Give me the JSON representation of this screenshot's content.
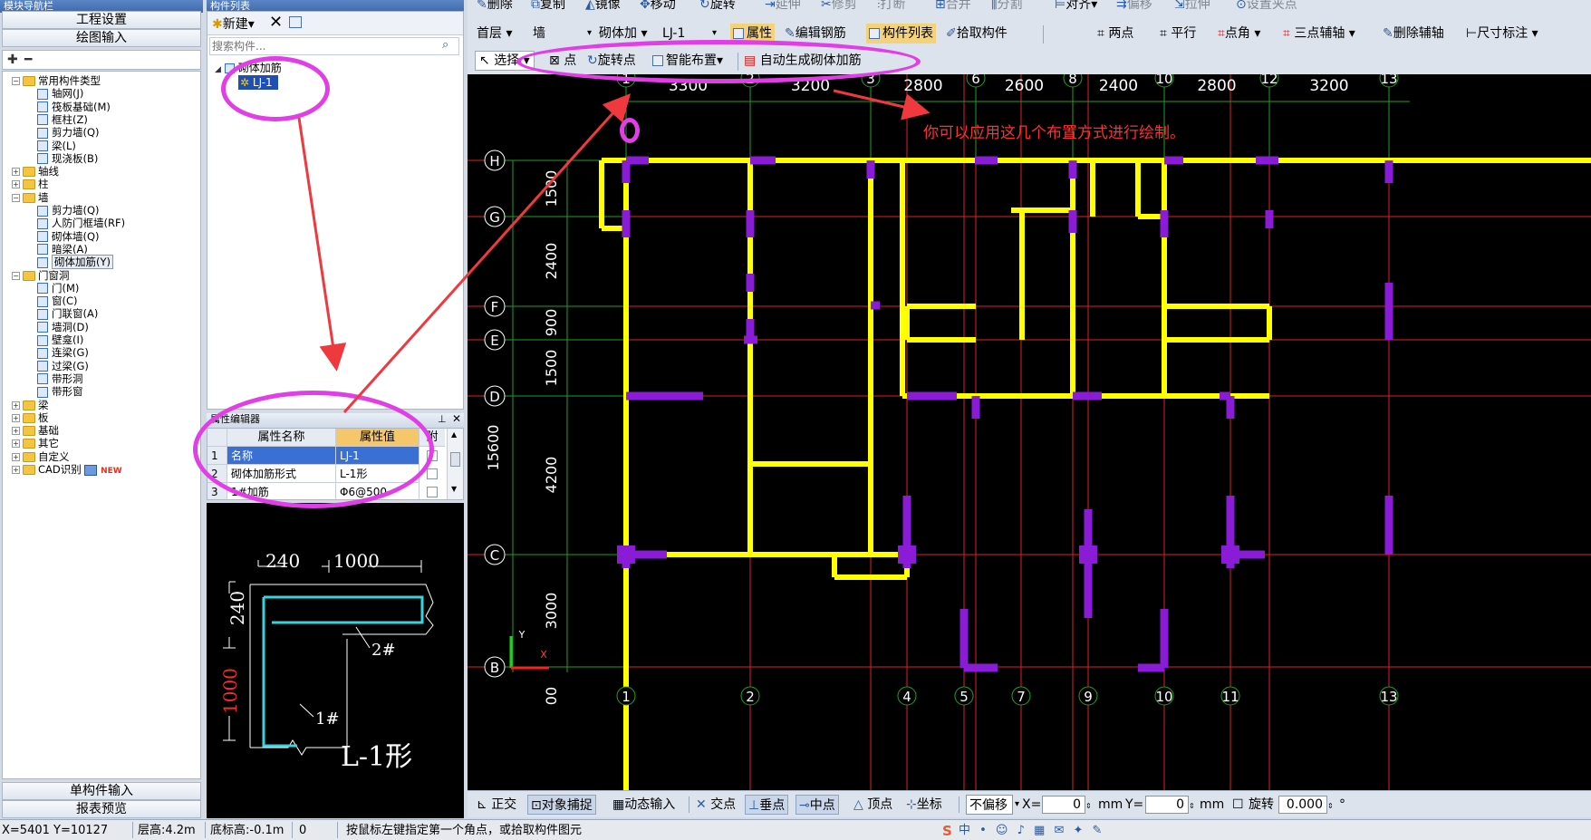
{
  "left_panel": {
    "title": "模块导航栏",
    "buttons": [
      "工程设置",
      "绘图输入"
    ],
    "bottom_buttons": [
      "单构件输入",
      "报表预览"
    ],
    "tree": [
      {
        "label": "常用构件类型",
        "level": 0,
        "exp": "-",
        "type": "folder"
      },
      {
        "label": "轴网(J)",
        "level": 1,
        "type": "item"
      },
      {
        "label": "筏板基础(M)",
        "level": 1,
        "type": "item"
      },
      {
        "label": "框柱(Z)",
        "level": 1,
        "type": "item"
      },
      {
        "label": "剪力墙(Q)",
        "level": 1,
        "type": "item"
      },
      {
        "label": "梁(L)",
        "level": 1,
        "type": "item"
      },
      {
        "label": "现浇板(B)",
        "level": 1,
        "type": "item"
      },
      {
        "label": "轴线",
        "level": 0,
        "exp": "+",
        "type": "folder"
      },
      {
        "label": "柱",
        "level": 0,
        "exp": "+",
        "type": "folder"
      },
      {
        "label": "墙",
        "level": 0,
        "exp": "-",
        "type": "folder"
      },
      {
        "label": "剪力墙(Q)",
        "level": 1,
        "type": "item"
      },
      {
        "label": "人防门框墙(RF)",
        "level": 1,
        "type": "item"
      },
      {
        "label": "砌体墙(Q)",
        "level": 1,
        "type": "item"
      },
      {
        "label": "暗梁(A)",
        "level": 1,
        "type": "item"
      },
      {
        "label": "砌体加筋(Y)",
        "level": 1,
        "type": "item",
        "selected": true
      },
      {
        "label": "门窗洞",
        "level": 0,
        "exp": "-",
        "type": "folder"
      },
      {
        "label": "门(M)",
        "level": 1,
        "type": "item"
      },
      {
        "label": "窗(C)",
        "level": 1,
        "type": "item"
      },
      {
        "label": "门联窗(A)",
        "level": 1,
        "type": "item"
      },
      {
        "label": "墙洞(D)",
        "level": 1,
        "type": "item"
      },
      {
        "label": "壁龛(I)",
        "level": 1,
        "type": "item"
      },
      {
        "label": "连梁(G)",
        "level": 1,
        "type": "item"
      },
      {
        "label": "过梁(G)",
        "level": 1,
        "type": "item"
      },
      {
        "label": "带形洞",
        "level": 1,
        "type": "item"
      },
      {
        "label": "带形窗",
        "level": 1,
        "type": "item"
      },
      {
        "label": "梁",
        "level": 0,
        "exp": "+",
        "type": "folder"
      },
      {
        "label": "板",
        "level": 0,
        "exp": "+",
        "type": "folder"
      },
      {
        "label": "基础",
        "level": 0,
        "exp": "+",
        "type": "folder"
      },
      {
        "label": "其它",
        "level": 0,
        "exp": "+",
        "type": "folder"
      },
      {
        "label": "自定义",
        "level": 0,
        "exp": "+",
        "type": "folder"
      },
      {
        "label": "CAD识别",
        "level": 0,
        "exp": "+",
        "type": "folder",
        "badge": "NEW"
      }
    ]
  },
  "component_list": {
    "title": "构件列表",
    "new_label": "新建",
    "search_placeholder": "搜索构件...",
    "tree_root": "砌体加筋",
    "tree_item": "LJ-1"
  },
  "property_editor": {
    "title": "属性编辑器",
    "col_name": "属性名称",
    "col_value": "属性值",
    "col_extra": "附",
    "rows": [
      {
        "idx": "1",
        "name": "名称",
        "value": "LJ-1"
      },
      {
        "idx": "2",
        "name": "砌体加筋形式",
        "value": "L-1形"
      },
      {
        "idx": "3",
        "name": "1#加筋",
        "value": "Φ6@500"
      }
    ]
  },
  "preview": {
    "dim_top_left": "240",
    "dim_top_right": "1000",
    "dim_left_top": "240",
    "dim_left_bottom": "1000",
    "bar2": "2#",
    "bar1": "1#",
    "shape_name": "L-1形"
  },
  "toolbar1": [
    "删除",
    "复制",
    "镜像",
    "移动",
    "旋转",
    "延伸",
    "修剪",
    "打断",
    "合并",
    "分割",
    "对齐",
    "偏移",
    "拉伸",
    "设置夹点"
  ],
  "toolbar2": {
    "floor": "首层",
    "category": "墙",
    "type": "砌体加",
    "item": "LJ-1",
    "buttons": [
      "属性",
      "编辑钢筋",
      "构件列表",
      "拾取构件",
      "两点",
      "平行",
      "点角",
      "三点辅轴",
      "删除辅轴",
      "尺寸标注"
    ]
  },
  "toolbar3": [
    "选择",
    "点",
    "旋转点",
    "智能布置",
    "自动生成砌体加筋"
  ],
  "annotation_text": "你可以应用这几个布置方式进行绘制。",
  "drawing": {
    "top_axes": [
      "1",
      "2",
      "3",
      "6",
      "8",
      "10",
      "12",
      "13"
    ],
    "top_dims": [
      "3300",
      "3200",
      "2800",
      "2600",
      "2400",
      "2800",
      "3200"
    ],
    "bottom_axes": [
      "1",
      "2",
      "4",
      "5",
      "7",
      "9",
      "10",
      "11",
      "13"
    ],
    "row_axes": [
      "H",
      "G",
      "F",
      "E",
      "D",
      "C",
      "B"
    ],
    "left_dims": [
      "1500",
      "2400",
      "900",
      "1500",
      "4200",
      "3000",
      "00"
    ],
    "total_dim": "15600",
    "ucs_x": "X",
    "ucs_y": "Y"
  },
  "snap_bar": {
    "buttons": [
      "正交",
      "对象捕捉",
      "动态输入",
      "交点",
      "垂点",
      "中点",
      "顶点",
      "坐标"
    ],
    "offset_mode": "不偏移",
    "x_label": "X=",
    "x_value": "0",
    "unit": "mm",
    "y_label": "Y=",
    "y_value": "0",
    "rotate_label": "旋转",
    "rotate_value": "0.000",
    "degree": "°"
  },
  "status": {
    "coords": "X=5401 Y=10127",
    "floor_height": "层高:4.2m",
    "bottom_elev": "底标高:-0.1m",
    "zero": "0",
    "hint": "按鼠标左键指定第一个角点，或拾取构件图元"
  }
}
